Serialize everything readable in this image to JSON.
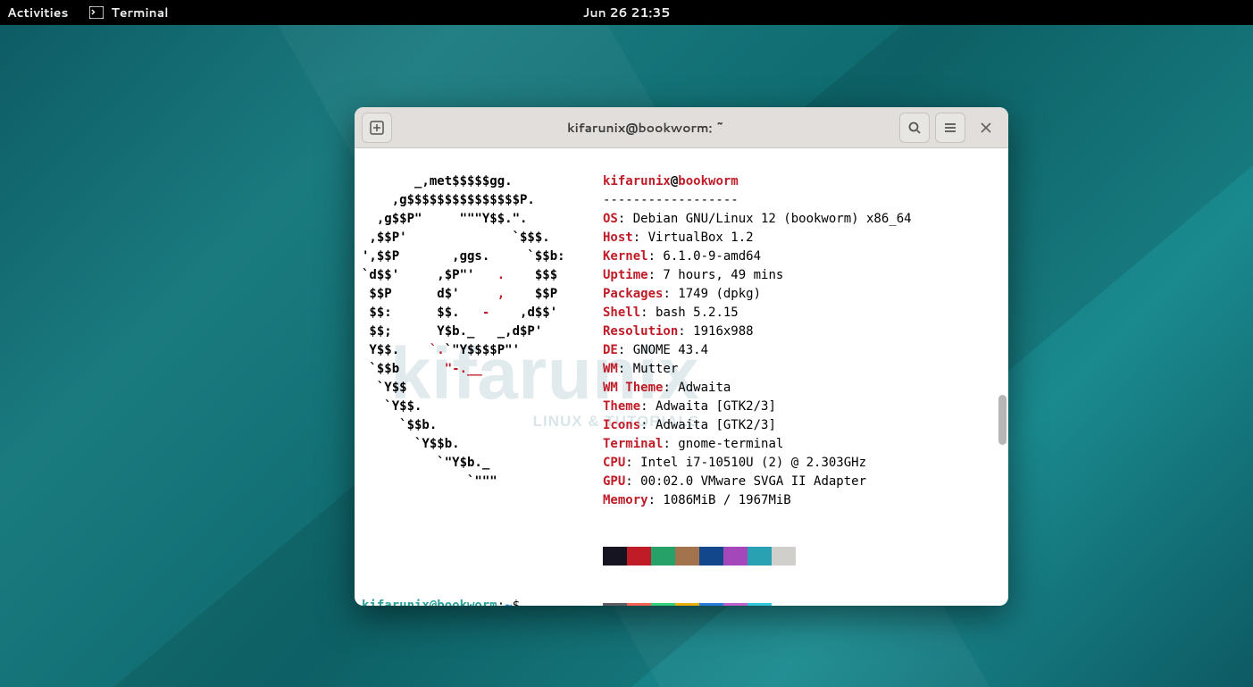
{
  "topbar": {
    "activities": "Activities",
    "app": "Terminal",
    "datetime": "Jun 26  21:35"
  },
  "window": {
    "title": "kifarunix@bookworm: ~"
  },
  "neofetch": {
    "user": "kifarunix",
    "host": "bookworm",
    "sep": "------------------",
    "os_k": "OS",
    "os_v": ": Debian GNU/Linux 12 (bookworm) x86_64",
    "host_k": "Host",
    "host_v": ": VirtualBox 1.2",
    "kernel_k": "Kernel",
    "kernel_v": ": 6.1.0-9-amd64",
    "uptime_k": "Uptime",
    "uptime_v": ": 7 hours, 49 mins",
    "packages_k": "Packages",
    "packages_v": ": 1749 (dpkg)",
    "shell_k": "Shell",
    "shell_v": ": bash 5.2.15",
    "res_k": "Resolution",
    "res_v": ": 1916x988",
    "de_k": "DE",
    "de_v": ": GNOME 43.4",
    "wm_k": "WM",
    "wm_v": ": Mutter",
    "wmtheme_k": "WM Theme",
    "wmtheme_v": ": Adwaita",
    "theme_k": "Theme",
    "theme_v": ": Adwaita [GTK2/3]",
    "icons_k": "Icons",
    "icons_v": ": Adwaita [GTK2/3]",
    "terminal_k": "Terminal",
    "terminal_v": ": gnome-terminal",
    "cpu_k": "CPU",
    "cpu_v": ": Intel i7-10510U (2) @ 2.303GHz",
    "gpu_k": "GPU",
    "gpu_v": ": 00:02.0 VMware SVGA II Adapter",
    "mem_k": "Memory",
    "mem_v": ": 1086MiB / 1967MiB"
  },
  "ascii": {
    "l0": "       _,met$$$$$gg.",
    "l1": "    ,g$$$$$$$$$$$$$$$P.",
    "l2": "  ,g$$P\"     \"\"\"Y$$.\".",
    "l3": " ,$$P'              `$$$.",
    "l4a": "',$$P       ,ggs.     `$$b:",
    "l5a": "`d$$'     ,$P\"'   ",
    "l5b": ".",
    "l5c": "    $$$",
    "l6a": " $$P      d$'     ",
    "l6b": ",",
    "l6c": "    $$P",
    "l7a": " $$:      $$.   ",
    "l7b": "-",
    "l7c": "    ,d$$'",
    "l8a": " $$;      Y$b._   _,d$P'",
    "l9a": " Y$$.    ",
    "l9b": "`.",
    "l9c": "`\"Y$$$$P\"'",
    "l10a": " `$$b      ",
    "l10b": "\"-.__",
    "l11": "  `Y$$",
    "l12": "   `Y$$.",
    "l13": "     `$$b.",
    "l14": "       `Y$$b.",
    "l15": "          `\"Y$b._",
    "l16": "              `\"\"\""
  },
  "colors": {
    "row1": [
      "#171421",
      "#c01c28",
      "#26a269",
      "#a2734c",
      "#12488b",
      "#a347ba",
      "#2aa1b3",
      "#d0cfcc"
    ],
    "row2": [
      "#5e5c64",
      "#f66151",
      "#33d17a",
      "#e9ad0c",
      "#2a7bde",
      "#c061cb",
      "#33c7de",
      "#ffffff"
    ]
  },
  "prompt": {
    "user": "kifarunix@bookworm",
    "colon": ":",
    "path": "~",
    "dollar": "$ "
  },
  "watermark": {
    "brand": "kifarunix",
    "tag": "LINUX & TUTORIALS"
  }
}
